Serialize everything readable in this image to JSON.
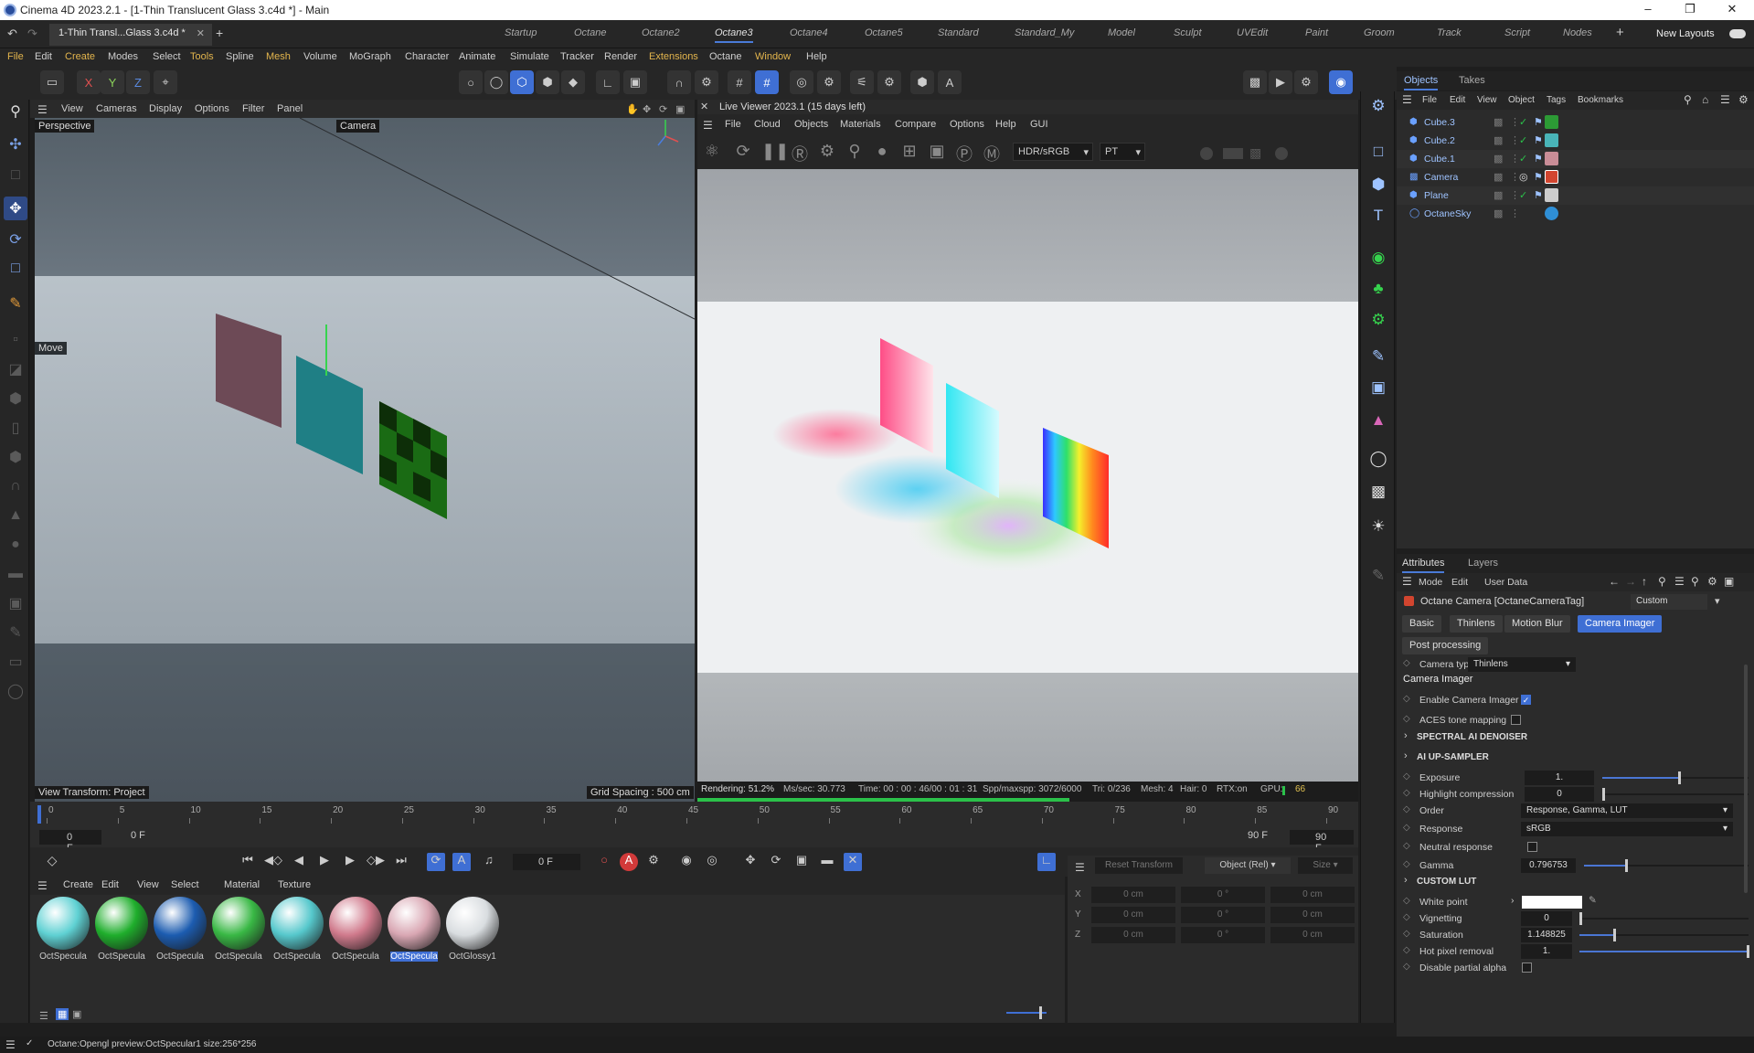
{
  "window": {
    "title": "Cinema 4D 2023.2.1 - [1-Thin Translucent Glass 3.c4d *] - Main",
    "doc_tab": "1-Thin Transl...Glass 3.c4d *"
  },
  "layouts": [
    "Startup",
    "Octane",
    "Octane2",
    "Octane3",
    "Octane4",
    "Octane5",
    "Standard",
    "Standard_My",
    "Model",
    "Sculpt",
    "UVEdit",
    "Paint",
    "Groom",
    "Track",
    "Script",
    "Nodes"
  ],
  "active_layout": "Octane3",
  "new_layouts": "New Layouts",
  "menu": [
    "File",
    "Edit",
    "Create",
    "Modes",
    "Select",
    "Tools",
    "Spline",
    "Mesh",
    "Volume",
    "MoGraph",
    "Character",
    "Animate",
    "Simulate",
    "Tracker",
    "Render",
    "Extensions",
    "Octane",
    "Window",
    "Help"
  ],
  "axes": {
    "x": "X",
    "y": "Y",
    "z": "Z"
  },
  "viewport": {
    "menu": [
      "View",
      "Cameras",
      "Display",
      "Options",
      "Filter",
      "Panel"
    ],
    "name": "Perspective",
    "camera": "Camera",
    "move": "Move",
    "view_transform": "View Transform: Project",
    "grid_spacing": "Grid Spacing : 500 cm"
  },
  "live_viewer": {
    "title": "Live Viewer 2023.1 (15 days left)",
    "menu": [
      "File",
      "Cloud",
      "Objects",
      "Materials",
      "Compare",
      "Options",
      "Help",
      "GUI"
    ],
    "color_mode": "HDR/sRGB",
    "kernel": "PT",
    "status": {
      "rendering": "Rendering: 51.2%",
      "ms_sec": "Ms/sec: 30.773",
      "time": "Time: 00 : 00 : 46/00 : 01 : 31",
      "spp": "Spp/maxspp: 3072/6000",
      "tri": "Tri: 0/236",
      "mesh": "Mesh: 4",
      "hair": "Hair: 0",
      "rtx": "RTX:on",
      "gpu": "GPU:",
      "gpu_val": "66"
    },
    "progress": 0.512
  },
  "timeline": {
    "ticks": [
      "0",
      "5",
      "10",
      "15",
      "20",
      "25",
      "30",
      "35",
      "40",
      "45",
      "50",
      "55",
      "60",
      "65",
      "70",
      "75",
      "80",
      "85",
      "90"
    ],
    "start": "0 F",
    "start2": "0 F",
    "end": "90 F",
    "end2": "90 F",
    "current": "0 F"
  },
  "material_manager": {
    "menu": [
      "Create",
      "Edit",
      "View",
      "Select",
      "Material",
      "Texture"
    ],
    "materials": [
      {
        "name": "OctSpecula",
        "color": "#5fd1d3"
      },
      {
        "name": "OctSpecula",
        "color": "#1fae2c"
      },
      {
        "name": "OctSpecula",
        "color": "#1c5cb0"
      },
      {
        "name": "OctSpecula",
        "color": "#39b845"
      },
      {
        "name": "OctSpecula",
        "color": "#56c8cc"
      },
      {
        "name": "OctSpecula",
        "color": "#d07a8c"
      },
      {
        "name": "OctSpecula",
        "color": "#d9a7b3"
      },
      {
        "name": "OctGlossy1",
        "color": "#d9dde0"
      }
    ],
    "selected_index": 6
  },
  "coords": {
    "reset": "Reset Transform",
    "mode": "Object (Rel)",
    "size": "Size",
    "rows": [
      {
        "axis": "X",
        "a": "0 cm",
        "b": "0 °",
        "c": "0 cm"
      },
      {
        "axis": "Y",
        "a": "0 cm",
        "b": "0 °",
        "c": "0 cm"
      },
      {
        "axis": "Z",
        "a": "0 cm",
        "b": "0 °",
        "c": "0 cm"
      }
    ]
  },
  "objects": {
    "tabs": [
      "Objects",
      "Takes"
    ],
    "menu": [
      "File",
      "Edit",
      "View",
      "Object",
      "Tags",
      "Bookmarks"
    ],
    "items": [
      {
        "name": "Cube.3",
        "tag": "#2c9a35"
      },
      {
        "name": "Cube.2",
        "tag": "#49b4b8"
      },
      {
        "name": "Cube.1",
        "tag": "#c98d97"
      },
      {
        "name": "Camera",
        "tag": "#d2452f"
      },
      {
        "name": "Plane",
        "tag": "#cccccc"
      },
      {
        "name": "OctaneSky",
        "tag": "#2f8fd6"
      }
    ]
  },
  "attributes": {
    "tabs": [
      "Attributes",
      "Layers"
    ],
    "menu": [
      "Mode",
      "Edit",
      "User Data"
    ],
    "header": "Octane Camera [OctaneCameraTag]",
    "preset": "Custom",
    "subtabs": [
      "Basic",
      "Thinlens",
      "Motion Blur",
      "Camera Imager"
    ],
    "post_processing": "Post processing",
    "camera_type_label": "Camera type",
    "camera_type": "Thinlens",
    "section": "Camera Imager",
    "enable_imager": "Enable Camera Imager",
    "aces": "ACES tone mapping",
    "spectral": "SPECTRAL AI DENOISER",
    "upsampler": "AI UP-SAMPLER",
    "exposure_label": "Exposure",
    "exposure": "1.",
    "highlight_label": "Highlight compression",
    "highlight": "0",
    "order_label": "Order",
    "order": "Response, Gamma, LUT",
    "response_label": "Response",
    "response": "sRGB",
    "neutral_label": "Neutral response",
    "gamma_label": "Gamma",
    "gamma": "0.796753",
    "custom_lut": "CUSTOM LUT",
    "white_label": "White point",
    "vignetting_label": "Vignetting",
    "vignetting": "0",
    "saturation_label": "Saturation",
    "saturation": "1.148825",
    "hotpixel_label": "Hot pixel removal",
    "hotpixel": "1.",
    "disable_alpha": "Disable partial alpha"
  },
  "statusbar": "Octane:Opengl preview:OctSpecular1  size:256*256"
}
